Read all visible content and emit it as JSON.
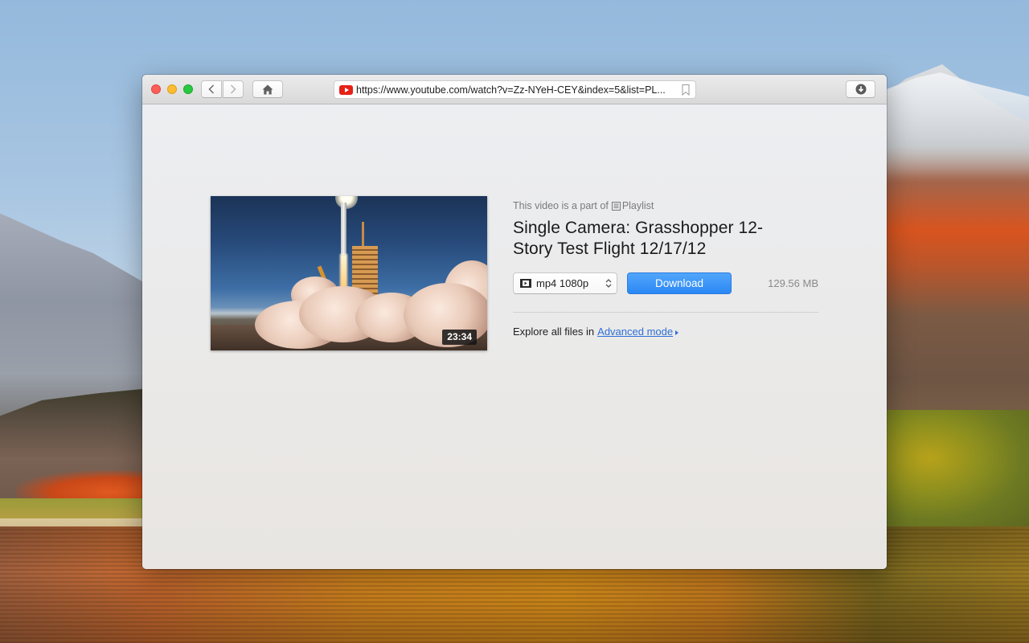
{
  "desktop": {
    "wallpaper": "mountain-lake-autumn"
  },
  "window": {
    "traffic_lights": {
      "close": "#fc5f57",
      "minimize": "#fdbc2e",
      "maximize": "#28c840"
    },
    "toolbar": {
      "back_icon": "chevron-left-icon",
      "forward_icon": "chevron-right-icon",
      "home_icon": "home-icon",
      "download_icon": "download-circle-icon",
      "url_bar": {
        "site_icon": "youtube-icon",
        "url": "https://www.youtube.com/watch?v=Zz-NYeH-CEY&index=5&list=PL...",
        "bookmark_icon": "bookmark-icon"
      }
    }
  },
  "video": {
    "duration": "23:34",
    "thumbnail": "rocket-launch-thumbnail",
    "playlist_prefix": "This video is a part of",
    "playlist_label": "Playlist",
    "title": "Single Camera: Grasshopper 12-Story Test Flight 12/17/12",
    "format": {
      "selected": "mp4 1080p",
      "icon": "film-icon"
    },
    "download_label": "Download",
    "file_size": "129.56 MB",
    "explore_prefix": "Explore all files in",
    "advanced_mode_label": "Advanced mode"
  },
  "colors": {
    "accent_blue": "#2a87f4",
    "link_blue": "#2d6fd6",
    "youtube_red": "#e62117"
  }
}
